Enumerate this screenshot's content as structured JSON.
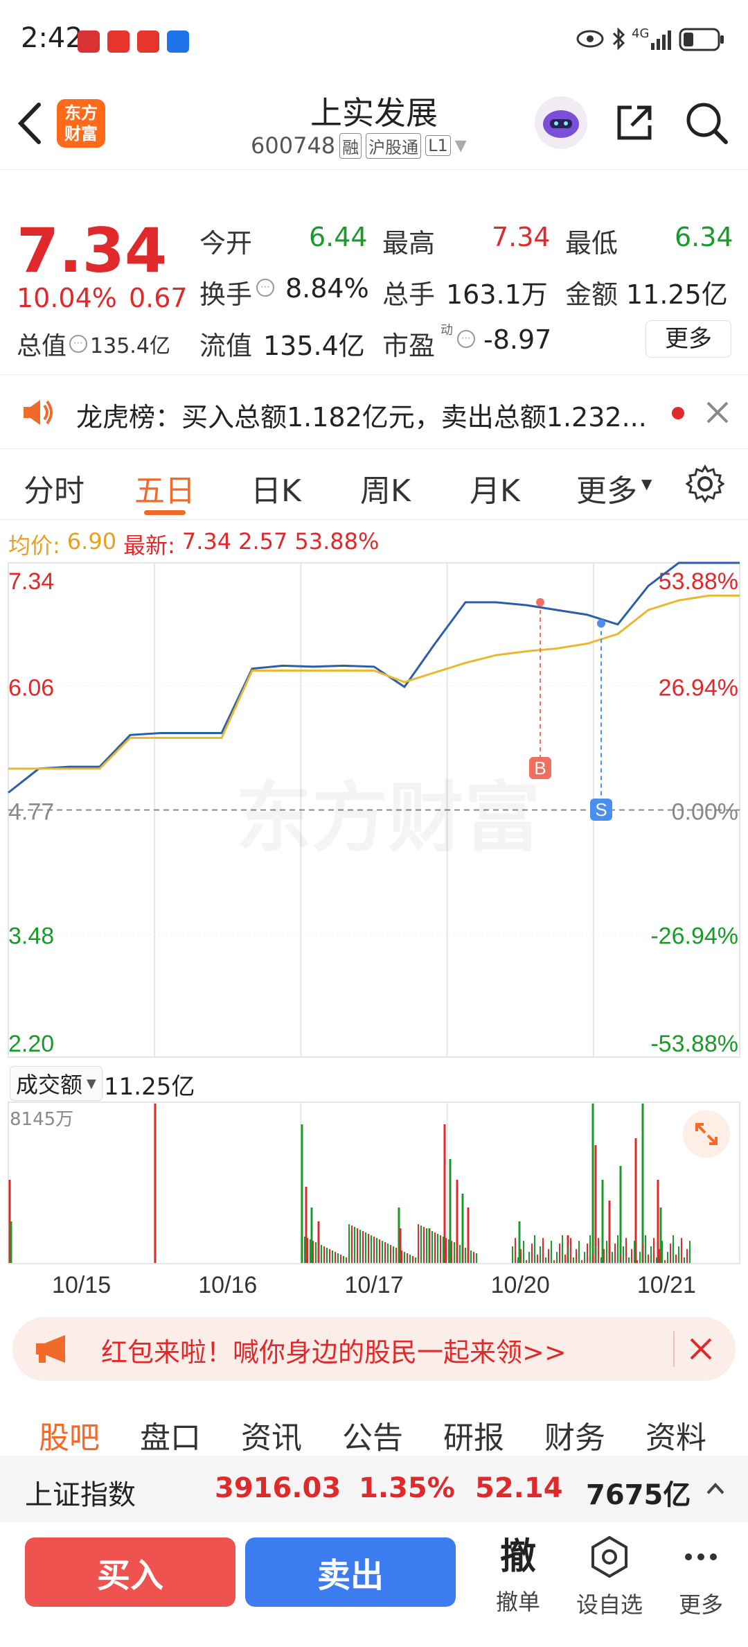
{
  "status_bar": {
    "time": "2:42",
    "network": "4G"
  },
  "header": {
    "logo_text_1": "东方",
    "logo_text_2": "财富",
    "stock_name": "上实发展",
    "stock_code": "600748",
    "tags": [
      "融",
      "沪股通",
      "L1"
    ]
  },
  "quote": {
    "price": "7.34",
    "change_pct": "10.04%",
    "change_amt": "0.67",
    "total_value_label": "总值",
    "total_value": "135.4亿",
    "fields": [
      {
        "label": "今开",
        "value": "6.44"
      },
      {
        "label": "最高",
        "value": "7.34"
      },
      {
        "label": "最低",
        "value": "6.34"
      },
      {
        "label": "换手",
        "value": "8.84%"
      },
      {
        "label": "总手",
        "value": "163.1万"
      },
      {
        "label": "金额",
        "value": "11.25亿"
      },
      {
        "label": "流值",
        "value": "135.4亿"
      },
      {
        "label": "市盈",
        "value": "-8.97",
        "sup": "动"
      }
    ],
    "more_button": "更多"
  },
  "notice": {
    "text": "龙虎榜：买入总额1.182亿元，卖出总额1.232..."
  },
  "tabs": [
    "分时",
    "五日",
    "日K",
    "周K",
    "月K",
    "更多"
  ],
  "active_tab": "五日",
  "chart_info": {
    "avg_label": "均价:",
    "avg_value": "6.90",
    "latest_label": "最新:",
    "latest_value": "7.34",
    "latest_change": "2.57",
    "latest_pct": "53.88%"
  },
  "chart_data": {
    "type": "line",
    "title": "",
    "x": [
      "10/15",
      "10/16",
      "10/17",
      "10/20",
      "10/21"
    ],
    "y_ticks": [
      "7.34",
      "6.06",
      "4.77",
      "3.48",
      "2.20"
    ],
    "y_ticks_pct": [
      "53.88%",
      "26.94%",
      "0.00%",
      "-26.94%",
      "-53.88%"
    ],
    "ylim": [
      2.2,
      7.34
    ],
    "base_price": 4.77,
    "series": [
      {
        "color": "#2a5fa8",
        "values": [
          4.95,
          5.2,
          5.22,
          5.22,
          5.55,
          5.57,
          5.57,
          5.57,
          6.24,
          6.27,
          6.26,
          6.27,
          6.26,
          6.05,
          6.5,
          6.93,
          6.93,
          6.9,
          6.85,
          6.8,
          6.7,
          7.1,
          7.34,
          7.34,
          7.34
        ]
      },
      {
        "color": "#e8b830",
        "values": [
          5.2,
          5.2,
          5.2,
          5.2,
          5.52,
          5.52,
          5.52,
          5.52,
          6.22,
          6.22,
          6.22,
          6.22,
          6.22,
          6.1,
          6.2,
          6.3,
          6.38,
          6.42,
          6.45,
          6.5,
          6.6,
          6.85,
          6.95,
          7.0,
          7.0
        ]
      }
    ],
    "markers": [
      {
        "label": "B",
        "price": 6.93
      },
      {
        "label": "S",
        "price": 6.71
      }
    ],
    "volume": {
      "label": "成交额",
      "total": "11.25亿",
      "max_label": "8145万"
    }
  },
  "banner": {
    "text": "红包来啦！喊你身边的股民一起来领>>"
  },
  "subtabs": [
    "股吧",
    "盘口",
    "资讯",
    "公告",
    "研报",
    "财务",
    "资料"
  ],
  "active_subtab": "股吧",
  "index_bar": {
    "name": "上证指数",
    "value": "3916.03",
    "pct": "1.35%",
    "change": "52.14",
    "amount": "7675亿"
  },
  "bottom_bar": {
    "buy": "买入",
    "sell": "卖出",
    "cancel_icon_char": "撤",
    "cancel": "撤单",
    "watch": "设自选",
    "more": "更多"
  },
  "colors": {
    "up": "#e0292b",
    "down": "#1a9a2a",
    "accent": "#f26a2a",
    "sell_blue": "#3b7cf0"
  }
}
